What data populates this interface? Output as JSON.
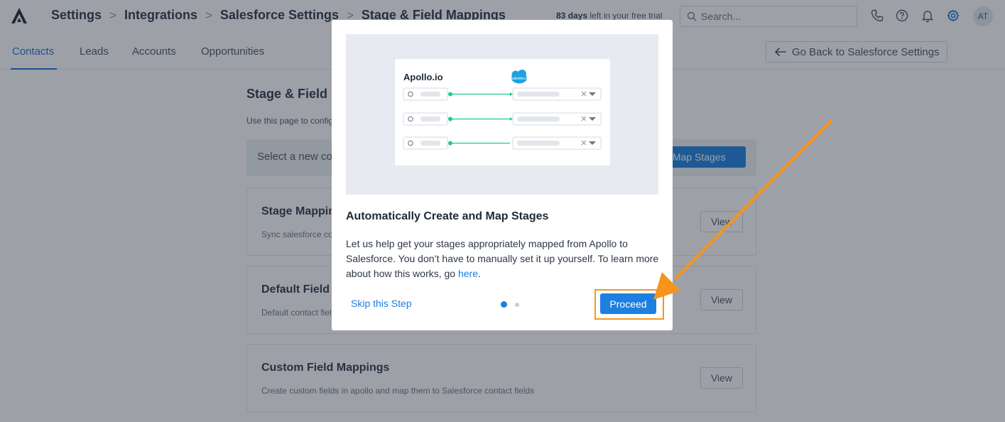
{
  "header": {
    "breadcrumbs": [
      "Settings",
      "Integrations",
      "Salesforce Settings",
      "Stage & Field Mappings"
    ],
    "trial_days": "83 days",
    "trial_rest": "left in your free trial",
    "search_placeholder": "Search...",
    "avatar_initials": "AT",
    "icons": [
      "phone-icon",
      "help-icon",
      "bell-icon",
      "gear-icon"
    ]
  },
  "tabs": [
    {
      "label": "Contacts",
      "active": true
    },
    {
      "label": "Leads",
      "active": false
    },
    {
      "label": "Accounts",
      "active": false
    },
    {
      "label": "Opportunities",
      "active": false
    }
  ],
  "back_button": "Go Back to Salesforce Settings",
  "main": {
    "title": "Stage & Field Mappings",
    "description": "Use this page to configure how Apollo contact stages and fields map to Salesforce",
    "banner_text": "Select a new contact stage mapping or let Apollo auto-map stages",
    "automap_label": "Auto-Map Stages",
    "cards": [
      {
        "title": "Stage Mappings",
        "description": "Sync salesforce contact stages with Apollo contact stages",
        "button": "View"
      },
      {
        "title": "Default Field Mappings",
        "description": "Default contact fields synced between Apollo and Salesforce",
        "button": "View"
      },
      {
        "title": "Custom Field Mappings",
        "description": "Create custom fields in apollo and map them to Salesforce contact fields",
        "button": "View"
      }
    ]
  },
  "modal": {
    "illustration": {
      "apollo_logo": "Apollo.io",
      "salesforce_logo": "salesforce"
    },
    "title": "Automatically Create and Map Stages",
    "body_text": "Let us help get your stages appropriately mapped from Apollo to Salesforce. You don’t have to manually set it up yourself. To learn more about how this works, go ",
    "link_text": "here",
    "body_end": ".",
    "skip_label": "Skip this Step",
    "proceed_label": "Proceed",
    "step_current": 1,
    "step_total": 2
  },
  "colors": {
    "accent": "#1e7fe0",
    "annotation": "#f7941d",
    "connector": "#1ec99a"
  }
}
